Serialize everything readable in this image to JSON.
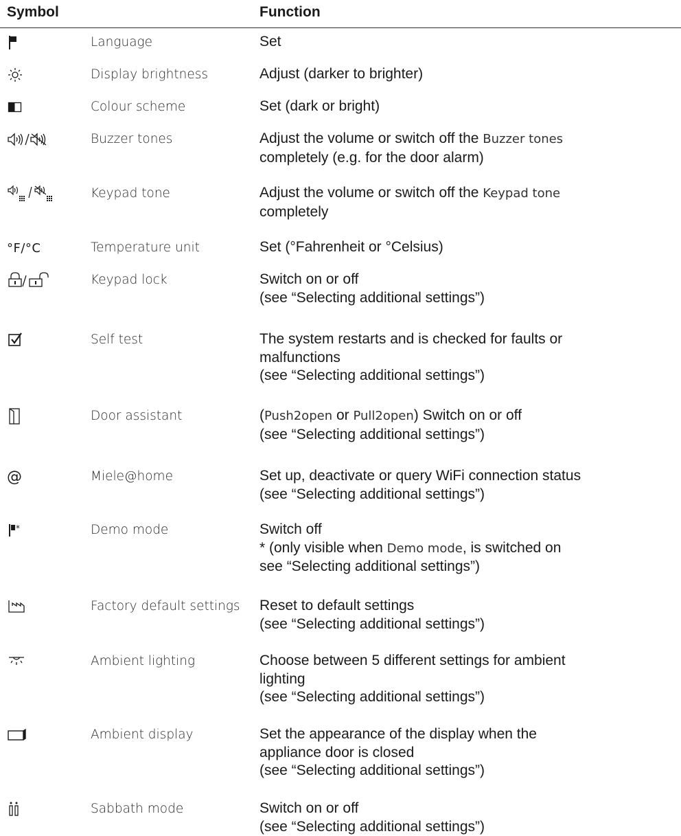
{
  "header": {
    "symbol_col": "Symbol",
    "function_col": "Function"
  },
  "rows": [
    {
      "icon": "flag-icon",
      "name": "Language",
      "func": [
        "Set"
      ]
    },
    {
      "icon": "brightness-icon",
      "name": "Display brightness",
      "func": [
        "Adjust (darker to brighter)"
      ]
    },
    {
      "icon": "colour-scheme-icon",
      "name": "Colour scheme",
      "func": [
        "Set (dark or bright)"
      ]
    },
    {
      "icon": "buzzer-tones-icon",
      "name": "Buzzer tones",
      "func_a": "Adjust the volume or switch off the ",
      "func_term": "Buzzer tones",
      "func_b": "completely (e.g. for the door alarm)"
    },
    {
      "icon": "keypad-tone-icon",
      "name": "Keypad tone",
      "func_a": "Adjust the volume or switch off the ",
      "func_term": "Keypad tone",
      "func_b": "completely"
    },
    {
      "icon": "temperature-unit-icon",
      "icon_text": "°F/°C",
      "name": "Temperature unit",
      "func": [
        "Set (°Fahrenheit or °Celsius)"
      ]
    },
    {
      "icon": "keypad-lock-icon",
      "name": "Keypad lock",
      "func": [
        "Switch on or off",
        "(see “Selecting additional settings”)"
      ]
    },
    {
      "icon": "self-test-icon",
      "name": "Self test",
      "func": [
        "The system restarts and is checked for faults or",
        "malfunctions",
        "(see “Selecting additional settings”)"
      ]
    },
    {
      "icon": "door-assistant-icon",
      "name": "Door assistant",
      "func_p1": "(",
      "func_t1": "Push2open",
      "func_p2": " or ",
      "func_t2": "Pull2open",
      "func_p3": ") Switch on or off",
      "func_b": "(see “Selecting additional settings”)"
    },
    {
      "icon": "at-icon",
      "icon_text": "@",
      "name": "Miele@home",
      "func": [
        "Set up, deactivate or query WiFi connection status",
        "(see “Selecting additional settings”)"
      ]
    },
    {
      "icon": "demo-mode-icon",
      "name": "Demo mode",
      "func_l1": "Switch off",
      "func_a": "* (only visible when ",
      "func_term": "Demo mode",
      "func_c": ", is switched on",
      "func_b": "see “Selecting additional settings”)"
    },
    {
      "icon": "factory-default-icon",
      "name": "Factory default settings",
      "func": [
        "Reset to default settings",
        "(see “Selecting additional settings”)"
      ]
    },
    {
      "icon": "ambient-lighting-icon",
      "name": "Ambient lighting",
      "func": [
        "Choose between 5 different settings for ambient",
        "lighting",
        "(see “Selecting additional settings”)"
      ]
    },
    {
      "icon": "ambient-display-icon",
      "name": "Ambient display",
      "func": [
        "Set the appearance of the display when the",
        "appliance door is closed",
        "(see “Selecting additional settings”)"
      ]
    },
    {
      "icon": "sabbath-mode-icon",
      "name": "Sabbath mode",
      "func": [
        "Switch on or off",
        "(see “Selecting additional settings”)"
      ]
    }
  ]
}
